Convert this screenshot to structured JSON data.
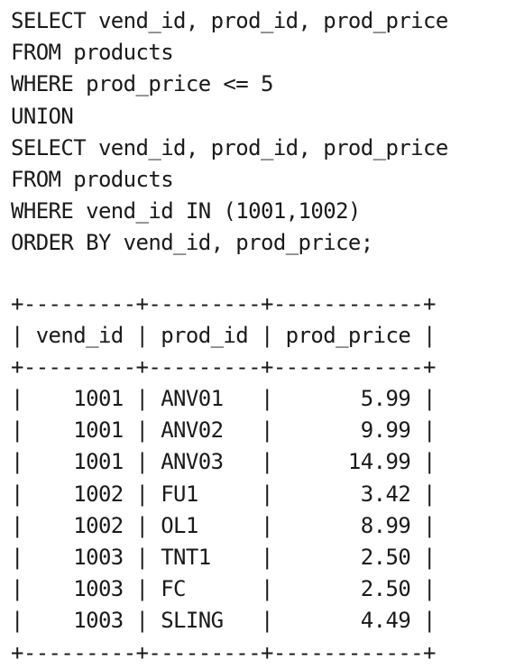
{
  "query": {
    "lines": [
      "SELECT vend_id, prod_id, prod_price",
      "FROM products",
      "WHERE prod_price <= 5",
      "UNION",
      "SELECT vend_id, prod_id, prod_price",
      "FROM products",
      "WHERE vend_id IN (1001,1002)",
      "ORDER BY vend_id, prod_price;"
    ]
  },
  "result": {
    "border": "+---------+---------+------------+",
    "header": "| vend_id | prod_id | prod_price |",
    "rows": [
      "|    1001 | ANV01   |       5.99 |",
      "|    1001 | ANV02   |       9.99 |",
      "|    1001 | ANV03   |      14.99 |",
      "|    1002 | FU1     |       3.42 |",
      "|    1002 | OL1     |       8.99 |",
      "|    1003 | TNT1    |       2.50 |",
      "|    1003 | FC      |       2.50 |",
      "|    1003 | SLING   |       4.49 |"
    ]
  }
}
